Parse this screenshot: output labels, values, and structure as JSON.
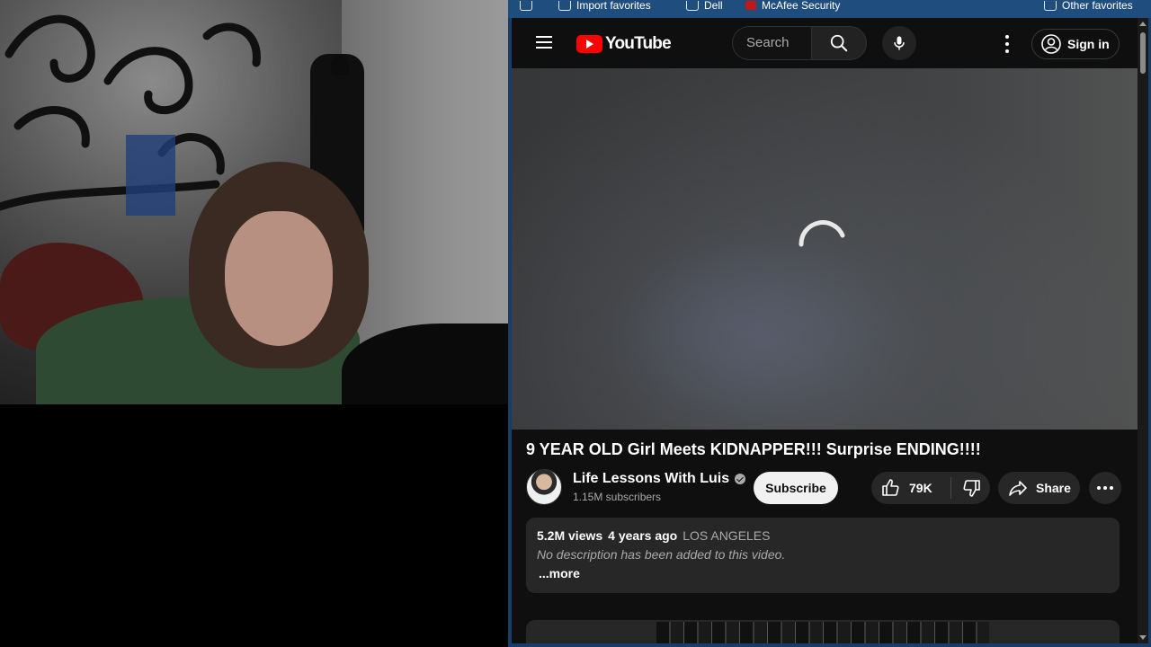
{
  "favorites_bar": {
    "import_label": "Import favorites",
    "dell_label": "Dell",
    "mcafee_label": "McAfee Security",
    "other_label": "Other favorites"
  },
  "header": {
    "logo_text": "YouTube",
    "search_placeholder": "Search",
    "signin_label": "Sign in"
  },
  "video": {
    "title": "9 YEAR OLD Girl Meets KIDNAPPER!!! Surprise ENDING!!!!",
    "channel_name": "Life Lessons With Luis",
    "subscribers": "1.15M subscribers",
    "subscribe_label": "Subscribe",
    "likes": "79K",
    "share_label": "Share"
  },
  "description": {
    "views": "5.2M views",
    "age": "4 years ago",
    "location": "LOS ANGELES",
    "text": "No description has been added to this video.",
    "more_label": "...more"
  },
  "colors": {
    "youtube_red": "#ff0000",
    "page_bg": "#0f0f0f",
    "chip_bg": "#272727",
    "browser_frame": "#173d6b"
  }
}
